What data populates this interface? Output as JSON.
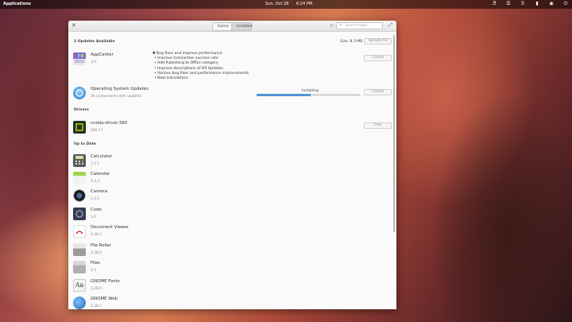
{
  "topbar": {
    "applications": "Applications",
    "date": "Sun, Oct 28",
    "time": "6:24 PM"
  },
  "tray_icons": [
    "volume-icon",
    "wifi-icon",
    "bluetooth-icon",
    "battery-icon",
    "notifications-icon",
    "power-icon"
  ],
  "window": {
    "tabs": [
      "Home",
      "Installed"
    ],
    "active_tab": "Installed",
    "search_placeholder": "Search Apps"
  },
  "updates": {
    "header": "2 Updates Available",
    "size": "Size: 8.3 MB",
    "update_all": "Update All",
    "items": [
      {
        "name": "AppCenter",
        "version": "3.0",
        "action": "Cancel",
        "notes": [
          "Bug fixes and improve performance.",
          "• Improve transaction success rate",
          "• Add Publishing to Office category",
          "• Improve descriptions of OS Updates",
          "• Various bug fixes and performance improvements",
          "• New translations"
        ]
      },
      {
        "name": "Operating System Updates",
        "subtitle": "36 components with updates",
        "action": "Cancel",
        "status": "Installing",
        "progress": 0.52
      }
    ]
  },
  "drivers": {
    "header": "Drivers",
    "items": [
      {
        "name": "nvidia-driver-390",
        "version": "390.77",
        "action": "Free"
      }
    ]
  },
  "uptodate": {
    "header": "Up to Date",
    "items": [
      {
        "name": "Calculator",
        "version": "1.5.1"
      },
      {
        "name": "Calendar",
        "version": "4.2.3"
      },
      {
        "name": "Camera",
        "version": "1.0.2"
      },
      {
        "name": "Code",
        "version": "3.0"
      },
      {
        "name": "Document Viewer",
        "version": "3.28.2"
      },
      {
        "name": "File Roller",
        "version": "3.28.0"
      },
      {
        "name": "Files",
        "version": "4.0"
      },
      {
        "name": "GNOME Fonts",
        "version": "3.28.0"
      },
      {
        "name": "GNOME Web",
        "version": "3.28.1"
      }
    ]
  },
  "colors": {
    "accent": "#4f94d4",
    "window_bg": "#fafafa"
  }
}
